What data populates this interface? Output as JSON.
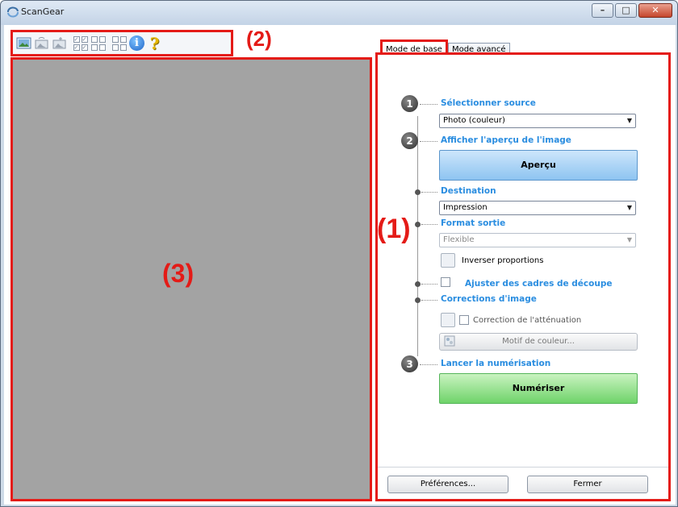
{
  "window": {
    "title": "ScanGear",
    "minimize_glyph": "–",
    "maximize_glyph": "□",
    "close_glyph": "✕"
  },
  "toolbar": {
    "icons": [
      "scan-photo-icon",
      "preview-rotate-left-icon",
      "preview-rotate-right-icon",
      "select-all-frames-icon",
      "deselect-frames-icon",
      "thumbnail-view-icon",
      "info-icon",
      "help-icon"
    ],
    "info_glyph": "i",
    "help_glyph": "?"
  },
  "callouts": {
    "panel": "(1)",
    "toolbar": "(2)",
    "preview": "(3)"
  },
  "tabs": [
    {
      "label": "Mode de base",
      "active": true
    },
    {
      "label": "Mode avancé",
      "active": false
    }
  ],
  "steps": {
    "step1": {
      "number": "1",
      "title": "Sélectionner source",
      "select_value": "Photo (couleur)"
    },
    "step2": {
      "number": "2",
      "title": "Afficher l'aperçu de l'image",
      "button": "Aperçu"
    },
    "destination": {
      "title": "Destination",
      "select_value": "Impression"
    },
    "output_size": {
      "title": "Format sortie",
      "select_value": "Flexible",
      "invert_label": "Inverser proportions"
    },
    "crop_frames": {
      "label": "Ajuster des cadres de découpe"
    },
    "corrections": {
      "title": "Corrections d'image",
      "fading_label": "Correction de l'atténuation",
      "color_pattern_button": "Motif de couleur..."
    },
    "step3": {
      "number": "3",
      "title": "Lancer la numérisation",
      "button": "Numériser"
    }
  },
  "footer": {
    "preferences_button": "Préférences...",
    "close_button": "Fermer"
  },
  "colors": {
    "highlight": "#e41b17",
    "section_title": "#2a8de0",
    "preview_background": "#a3a3a3"
  }
}
